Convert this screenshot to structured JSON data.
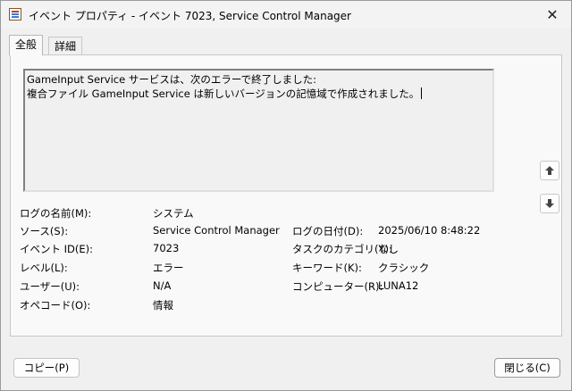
{
  "window": {
    "title": "イベント プロパティ - イベント 7023, Service Control Manager",
    "close_glyph": "✕"
  },
  "tabs": [
    {
      "label": "全般",
      "active": true
    },
    {
      "label": "詳細",
      "active": false
    }
  ],
  "message": {
    "line1": "GameInput Service サービスは、次のエラーで終了しました:",
    "line2": "複合ファイル GameInput Service は新しいバージョンの記憶域で作成されました。"
  },
  "fields": {
    "log_name": {
      "label": "ログの名前(M):",
      "value": "システム"
    },
    "source": {
      "label": "ソース(S):",
      "value": "Service Control Manager"
    },
    "event_id": {
      "label": "イベント ID(E):",
      "value": "7023"
    },
    "level": {
      "label": "レベル(L):",
      "value": "エラー"
    },
    "user": {
      "label": "ユーザー(U):",
      "value": "N/A"
    },
    "opcode": {
      "label": "オペコード(O):",
      "value": "情報"
    },
    "logged": {
      "label": "ログの日付(D):",
      "value": "2025/06/10 8:48:22"
    },
    "task_category": {
      "label": "タスクのカテゴリ(Y):",
      "value": "なし"
    },
    "keywords": {
      "label": "キーワード(K):",
      "value": "クラシック"
    },
    "computer": {
      "label": "コンピューター(R):",
      "value": "LUNA12"
    }
  },
  "buttons": {
    "copy": "コピー(P)",
    "close": "閉じる(C)"
  },
  "icons": {
    "up": "arrow-up-icon",
    "down": "arrow-down-icon",
    "app": "event-viewer-icon"
  }
}
